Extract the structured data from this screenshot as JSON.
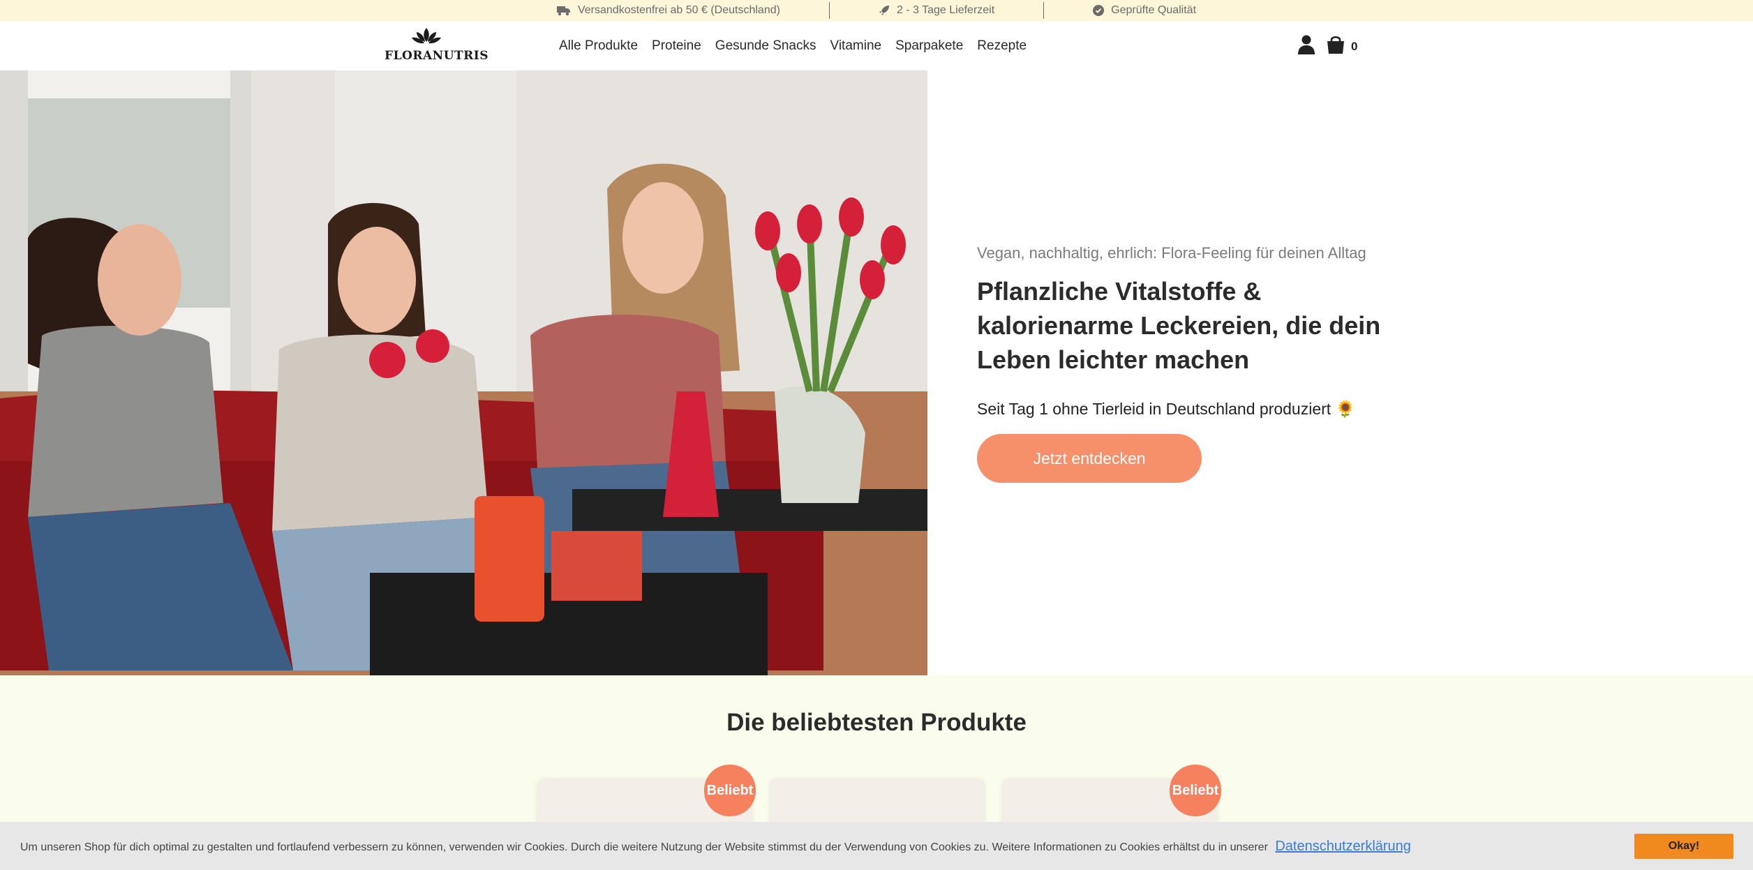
{
  "topbar": {
    "items": [
      {
        "text": "Versandkostenfrei ab 50 € (Deutschland)",
        "icon": "truck-icon"
      },
      {
        "text": "2 - 3 Tage Lieferzeit",
        "icon": "rocket-icon"
      },
      {
        "text": "Geprüfte Qualität",
        "icon": "check-circle-icon"
      }
    ]
  },
  "header": {
    "logo_text": "FLORANUTRIS",
    "nav": [
      "Alle Produkte",
      "Proteine",
      "Gesunde Snacks",
      "Vitamine",
      "Sparpakete",
      "Rezepte"
    ],
    "cart_count": "0"
  },
  "hero": {
    "kicker": "Vegan, nachhaltig, ehrlich: Flora-Feeling für deinen Alltag",
    "title": "Pflanzliche Vitalstoffe & kalorienarme Leckereien, die dein Leben leichter machen",
    "subtitle": "Seit Tag 1 ohne Tierleid in Deutschland produziert 🌻",
    "cta": "Jetzt entdecken"
  },
  "products": {
    "title": "Die beliebtesten Produkte",
    "badges": [
      "Beliebt",
      "Beliebt"
    ]
  },
  "cookie": {
    "text": "Um unseren Shop für dich optimal zu gestalten und fortlaufend verbessern zu können, verwenden wir Cookies. Durch die weitere Nutzung der Website stimmst du der Verwendung von Cookies zu. Weitere Informationen zu Cookies erhältst du in unserer",
    "link": "Datenschutzerklärung",
    "button": "Okay!"
  },
  "colors": {
    "topbar_bg": "#fdf6d8",
    "accent": "#f5906a",
    "badge": "#f5815e",
    "section_bg": "#fbfdec",
    "cookie_button": "#f08a1f",
    "link": "#3a7cd0"
  }
}
